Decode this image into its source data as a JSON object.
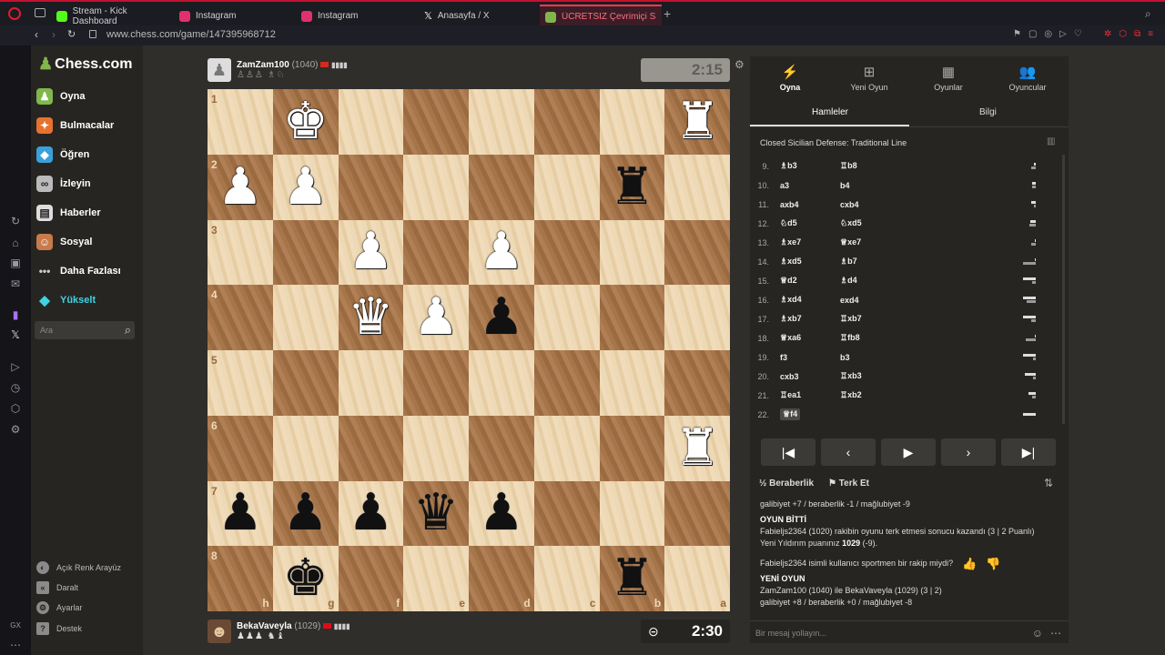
{
  "browser": {
    "tabs": [
      {
        "label": "Stream - Kick Dashboard",
        "color": "#53fc18"
      },
      {
        "label": "Instagram",
        "color": "#e1306c"
      },
      {
        "label": "Instagram",
        "color": "#e1306c"
      },
      {
        "label": "Anasayfa / X",
        "color": "#ffffff"
      },
      {
        "label": "ÜCRETSİZ Çevrimiçi Satrar",
        "color": "#81b64c"
      }
    ],
    "url": "www.chess.com/game/147395968712"
  },
  "sidebar": {
    "logo": "Chess.com",
    "items": [
      {
        "label": "Oyna",
        "icon": "pawn-icon"
      },
      {
        "label": "Bulmacalar",
        "icon": "puzzle-icon"
      },
      {
        "label": "Öğren",
        "icon": "learn-icon"
      },
      {
        "label": "İzleyin",
        "icon": "binoculars-icon"
      },
      {
        "label": "Haberler",
        "icon": "news-icon"
      },
      {
        "label": "Sosyal",
        "icon": "social-icon"
      },
      {
        "label": "Daha Fazlası",
        "icon": "more-icon"
      },
      {
        "label": "Yükselt",
        "icon": "diamond-icon"
      }
    ],
    "search_placeholder": "Ara",
    "bottom": [
      {
        "label": "Açık Renk Arayüz",
        "icon": "theme-icon"
      },
      {
        "label": "Daralt",
        "icon": "collapse-icon"
      },
      {
        "label": "Ayarlar",
        "icon": "gear-icon"
      },
      {
        "label": "Destek",
        "icon": "help-icon"
      }
    ]
  },
  "top_player": {
    "name": "ZamZam100",
    "rating": "(1040)",
    "captured": "♙♙♙ ♗♘",
    "clock": "2:15"
  },
  "bottom_player": {
    "name": "BekaVaveyla",
    "rating": "(1029)",
    "captured": "♟♟♟ ♞♝",
    "clock": "2:30"
  },
  "board": {
    "ranks": [
      "1",
      "2",
      "3",
      "4",
      "5",
      "6",
      "7",
      "8"
    ],
    "files": [
      "h",
      "g",
      "f",
      "e",
      "d",
      "c",
      "b",
      "a"
    ],
    "pieces": [
      {
        "r": 0,
        "c": 1,
        "p": "♚",
        "side": "w"
      },
      {
        "r": 0,
        "c": 7,
        "p": "♜",
        "side": "w"
      },
      {
        "r": 1,
        "c": 0,
        "p": "♟",
        "side": "w"
      },
      {
        "r": 1,
        "c": 1,
        "p": "♟",
        "side": "w"
      },
      {
        "r": 1,
        "c": 6,
        "p": "♜",
        "side": "b"
      },
      {
        "r": 2,
        "c": 2,
        "p": "♟",
        "side": "w"
      },
      {
        "r": 2,
        "c": 4,
        "p": "♟",
        "side": "w"
      },
      {
        "r": 3,
        "c": 2,
        "p": "♛",
        "side": "w"
      },
      {
        "r": 3,
        "c": 3,
        "p": "♟",
        "side": "w"
      },
      {
        "r": 3,
        "c": 4,
        "p": "♟",
        "side": "b"
      },
      {
        "r": 5,
        "c": 7,
        "p": "♜",
        "side": "w"
      },
      {
        "r": 6,
        "c": 0,
        "p": "♟",
        "side": "b"
      },
      {
        "r": 6,
        "c": 1,
        "p": "♟",
        "side": "b"
      },
      {
        "r": 6,
        "c": 2,
        "p": "♟",
        "side": "b"
      },
      {
        "r": 6,
        "c": 3,
        "p": "♛",
        "side": "b"
      },
      {
        "r": 6,
        "c": 4,
        "p": "♟",
        "side": "b"
      },
      {
        "r": 7,
        "c": 1,
        "p": "♚",
        "side": "b"
      },
      {
        "r": 7,
        "c": 6,
        "p": "♜",
        "side": "b"
      }
    ]
  },
  "panel": {
    "tabs": [
      {
        "label": "Oyna",
        "icon": "⚡"
      },
      {
        "label": "Yeni Oyun",
        "icon": "⊞"
      },
      {
        "label": "Oyunlar",
        "icon": "▦"
      },
      {
        "label": "Oyuncular",
        "icon": "👥"
      }
    ],
    "subtabs": [
      "Hamleler",
      "Bilgi"
    ],
    "opening": "Closed Sicilian Defense: Traditional Line",
    "moves": [
      {
        "n": "9.",
        "w": "♗b3",
        "b": "♖b8",
        "t": [
          0.14,
          0.35
        ]
      },
      {
        "n": "10.",
        "w": "a3",
        "b": "b4",
        "t": [
          0.26,
          0.26
        ]
      },
      {
        "n": "11.",
        "w": "axb4",
        "b": "cxb4",
        "t": [
          0.33,
          0.12
        ]
      },
      {
        "n": "12.",
        "w": "♘d5",
        "b": "♘xd5",
        "t": [
          0.44,
          0.51
        ]
      },
      {
        "n": "13.",
        "w": "♗xe7",
        "b": "♕xe7",
        "t": [
          0.1,
          0.35
        ]
      },
      {
        "n": "14.",
        "w": "♗xd5",
        "b": "♗b7",
        "t": [
          0.1,
          1.0
        ]
      },
      {
        "n": "15.",
        "w": "♕d2",
        "b": "♗d4",
        "t": [
          1.0,
          0.32
        ]
      },
      {
        "n": "16.",
        "w": "♗xd4",
        "b": "exd4",
        "t": [
          0.97,
          0.68
        ]
      },
      {
        "n": "17.",
        "w": "♗xb7",
        "b": "♖xb7",
        "t": [
          1.0,
          0.34
        ]
      },
      {
        "n": "18.",
        "w": "♕xa6",
        "b": "♖fb8",
        "t": [
          0.1,
          0.78
        ]
      },
      {
        "n": "19.",
        "w": "f3",
        "b": "b3",
        "t": [
          1.0,
          0.23
        ]
      },
      {
        "n": "20.",
        "w": "cxb3",
        "b": "♖xb3",
        "t": [
          0.83,
          0.18
        ]
      },
      {
        "n": "21.",
        "w": "♖ea1",
        "b": "♖xb2",
        "t": [
          0.59,
          0.3
        ]
      },
      {
        "n": "22.",
        "w": "♕f4",
        "b": "",
        "t": [
          1.0,
          0
        ]
      }
    ],
    "actions": {
      "draw": "Beraberlik",
      "resign": "Terk Et"
    },
    "chat": {
      "line1": "galibiyet +7 / beraberlik -1 / mağlubiyet -9",
      "over_title": "OYUN BİTTİ",
      "over_line": "Fabieljs2364 (1020) rakibin oyunu terk etmesi sonucu kazandı (3 | 2 Puanlı)",
      "rating_prefix": "Yeni Yıldırım puanınız ",
      "rating_value": "1029",
      "rating_suffix": " (-9).",
      "sport": "Fabieljs2364 isimli kullanıcı sportmen bir rakip miydi?",
      "new_title": "YENİ OYUN",
      "new_line": "ZamZam100 (1040) ile BekaVaveyla (1029) (3 | 2)",
      "new_stats": "galibiyet +8 / beraberlik +0 / mağlubiyet -8"
    },
    "message_placeholder": "Bir mesaj yollayın..."
  }
}
